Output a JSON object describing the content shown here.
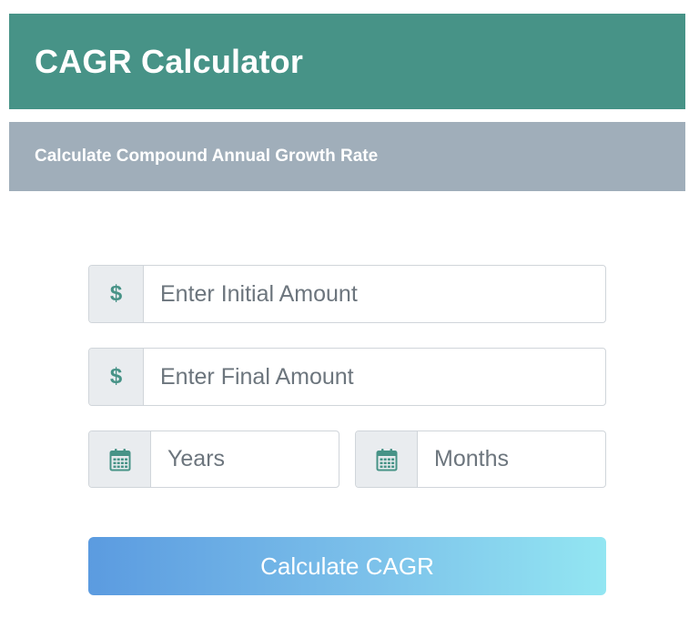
{
  "header": {
    "title": "CAGR Calculator",
    "color": "#479387"
  },
  "subheader": {
    "text": "Calculate Compound Annual Growth Rate",
    "color": "#a0aeba"
  },
  "form": {
    "initial_amount": {
      "icon": "dollar-sign",
      "icon_text": "$",
      "placeholder": "Enter Initial Amount",
      "value": ""
    },
    "final_amount": {
      "icon": "dollar-sign",
      "icon_text": "$",
      "placeholder": "Enter Final Amount",
      "value": ""
    },
    "years": {
      "icon": "calendar-icon",
      "placeholder": "Years",
      "value": ""
    },
    "months": {
      "icon": "calendar-icon",
      "placeholder": "Months",
      "value": ""
    },
    "submit_label": "Calculate CAGR"
  },
  "colors": {
    "accent": "#479387",
    "addon_bg": "#e9ecef",
    "button_gradient_start": "#5b9be0",
    "button_gradient_end": "#93e6f2"
  }
}
